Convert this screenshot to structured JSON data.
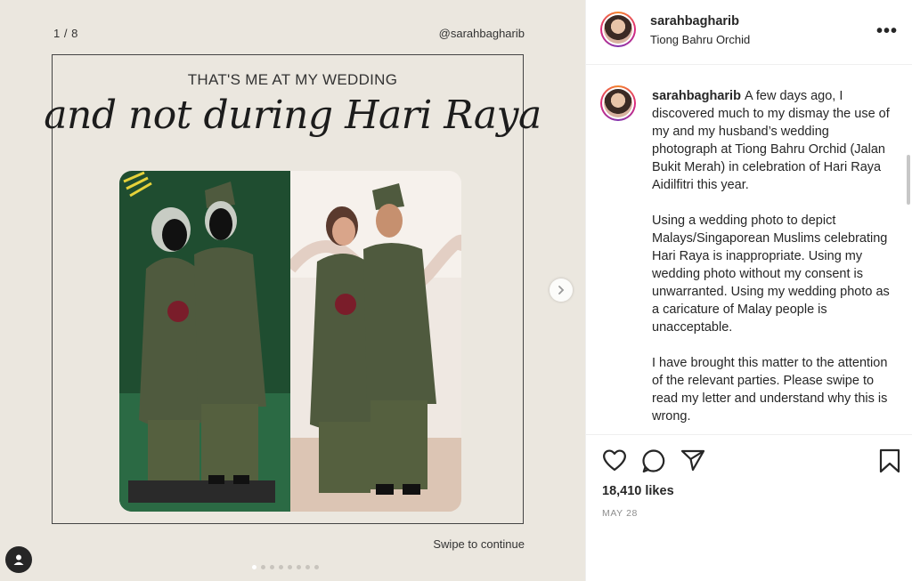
{
  "slide": {
    "counter": "1 / 8",
    "handle": "@sarahbagharib",
    "headline": "THAT'S ME AT MY WEDDING",
    "script_title": "and not during Hari Raya",
    "swipe_label": "Swipe to continue",
    "total_slides": 8,
    "current_slide": 1
  },
  "post": {
    "username": "sarahbagharib",
    "location": "Tiong Bahru Orchid",
    "more_icon": "more-horizontal-icon",
    "caption_paragraphs": [
      "A few days ago, I discovered much to my dismay the use of my and my husband’s wedding photograph at Tiong Bahru Orchid (Jalan Bukit Merah) in celebration of Hari Raya Aidilfitri this year.",
      "Using a wedding photo to depict Malays/Singaporean Muslims celebrating Hari Raya is inappropriate. Using my wedding photo without my consent is unwarranted. Using my wedding photo as a caricature of Malay people is unacceptable.",
      "I have brought this matter to the attention of the relevant parties. Please swipe to read my letter and understand why this is wrong."
    ],
    "likes": "18,410 likes",
    "date": "MAY 28"
  },
  "icons": {
    "like": "heart-icon",
    "comment": "comment-icon",
    "share": "paper-plane-icon",
    "save": "bookmark-icon",
    "next": "chevron-right-icon",
    "tag": "person-icon"
  },
  "colors": {
    "slide_background": "#ebe7df",
    "text_primary": "#262626",
    "text_secondary": "#8e8e8e",
    "outfit_green": "#4f5a3e"
  }
}
